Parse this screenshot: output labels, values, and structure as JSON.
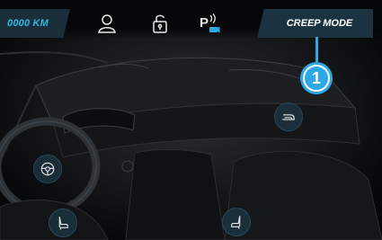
{
  "topbar": {
    "odometer": "0000 KM",
    "icons": [
      "user-icon",
      "unlock-icon",
      "parking-sensor-icon"
    ],
    "mode_button": "CREEP MODE"
  },
  "callout": {
    "label": "1"
  },
  "controls": {
    "icons": [
      "steering-wheel-icon",
      "driver-seat-icon",
      "passenger-seat-icon",
      "steering-column-icon"
    ]
  },
  "colors": {
    "accent": "#2fa8e6",
    "odometer_text": "#2fb7e8",
    "panel": "#1b3240",
    "background": "#050607"
  }
}
